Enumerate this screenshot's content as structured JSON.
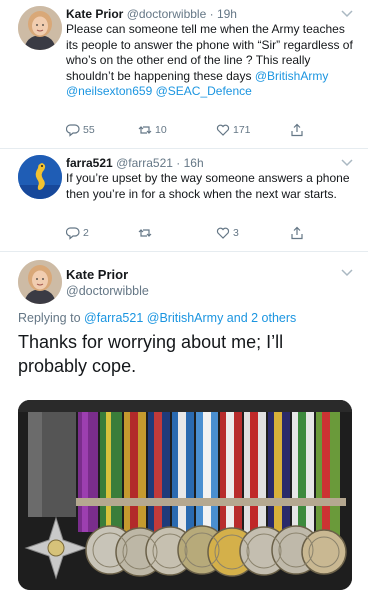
{
  "tweet1": {
    "name": "Kate Prior",
    "handle": "@doctorwibble",
    "time": "19h",
    "text_before": "Please can someone tell me when the Army teaches its people to answer the phone with “Sir” regardless of who’s on the other end of the line ? This really shouldn’t be happening these days ",
    "mention1": "@BritishArmy",
    "mention2": "@neilsexton659",
    "mention3": "@SEAC_Defence",
    "replies": "55",
    "retweets": "10",
    "likes": "171"
  },
  "tweet2": {
    "name": "farra521",
    "handle": "@farra521",
    "time": "16h",
    "text": "If you’re upset by the way someone answers a phone then you’re in for a shock when the next war starts.",
    "replies": "2",
    "retweets": "",
    "likes": "3"
  },
  "main_tweet": {
    "name": "Kate Prior",
    "handle": "@doctorwibble",
    "replying_prefix": "Replying to",
    "replying_to": "@farra521 @BritishArmy and 2 others",
    "text": "Thanks for worrying about me; I’ll probably cope."
  },
  "colors": {
    "link": "#1b95e0",
    "meta": "#657786",
    "text": "#14171a",
    "divider": "#e6ecf0"
  },
  "icons": [
    "reply-icon",
    "retweet-icon",
    "like-icon",
    "share-icon",
    "chevron-down-icon"
  ]
}
